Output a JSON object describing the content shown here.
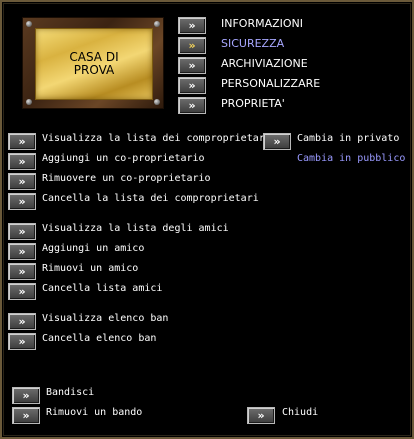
{
  "plaque": {
    "text": "CASA DI\nPROVA"
  },
  "tabs": [
    {
      "label": "INFORMAZIONI"
    },
    {
      "label": "SICUREZZA"
    },
    {
      "label": "ARCHIVIAZIONE"
    },
    {
      "label": "PERSONALIZZARE"
    },
    {
      "label": "PROPRIETA'"
    }
  ],
  "owners": {
    "view_list": "Visualizza la lista dei comproprietari",
    "add": "Aggiungi un co-proprietario",
    "remove": "Rimuovere un co-proprietario",
    "clear": "Cancella la lista dei comproprietari",
    "make_private": "Cambia in privato",
    "make_public": "Cambia in pubblico"
  },
  "friends": {
    "view_list": "Visualizza la lista degli amici",
    "add": "Aggiungi un amico",
    "remove": "Rimuovi un amico",
    "clear": "Cancella lista amici"
  },
  "bans": {
    "view_list": "Visualizza elenco ban",
    "clear": "Cancella elenco ban"
  },
  "footer": {
    "ban": "Bandisci",
    "unban": "Rimuovi un bando",
    "close": "Chiudi"
  },
  "colors": {
    "accent_blue": "#9a9aff",
    "gold": "#e6c45a",
    "frame": "#6b5a3a"
  }
}
